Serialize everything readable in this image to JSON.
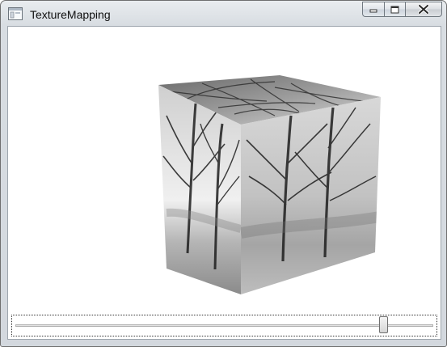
{
  "window": {
    "title": "TextureMapping",
    "icon": "app-window-icon"
  },
  "caption_buttons": {
    "minimize": "minimize-icon",
    "maximize": "maximize-icon",
    "close": "close-icon"
  },
  "scene": {
    "object": "textured-cube",
    "texture": "trees-in-fog"
  },
  "slider": {
    "value": 0.89
  }
}
